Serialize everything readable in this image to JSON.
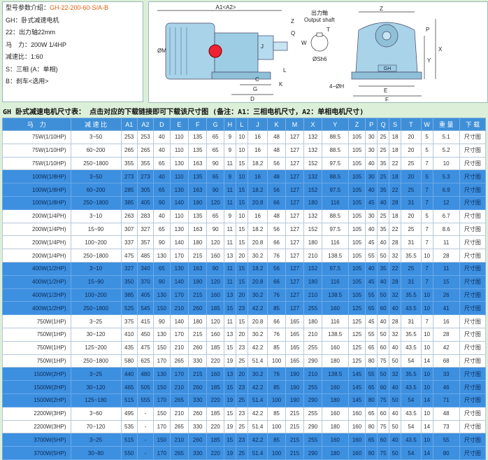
{
  "info": {
    "model_label": "型号参数介绍：",
    "model_code": "GH-22-200-60-S/A-B",
    "lines": [
      "GH：卧式减速电机",
      "22：出力轴22mm",
      "马　力：200W 1/4HP",
      "减速比：1:60",
      "S：三相 (A：单相)",
      "B：刹车<选用>"
    ]
  },
  "drawing": {
    "labels": {
      "a1": "A1<A2>",
      "output_cn": "出力軸",
      "output_en": "Output shaft",
      "z": "Z",
      "q": "Q",
      "j": "J",
      "m": "ØM",
      "w": "W",
      "t": "T",
      "s": "ØSh6",
      "g": "G",
      "k": "K",
      "c": "C",
      "d": "D",
      "l": "L",
      "h": "4−ØH",
      "y": "Y",
      "x": "X",
      "e": "E",
      "f": "F",
      "p": "P",
      "brand": "GH"
    }
  },
  "caption": "GH 卧式减速电机尺寸表： 点击对应的下载链接即可下载该尺寸图 (备注：A1：三相电机尺寸，A2：单相电机尺寸)",
  "table": {
    "headers": [
      "马　力",
      "减 速 比",
      "A1",
      "A2",
      "D",
      "E",
      "F",
      "G",
      "H",
      "L",
      "J",
      "K",
      "M",
      "X",
      "Y",
      "Z",
      "P",
      "Q",
      "S",
      "T",
      "W",
      "重 量",
      "下 载"
    ],
    "rows": [
      {
        "s": "w",
        "c": [
          "75W(1/10HP)",
          "3~50",
          "253",
          "253",
          "40",
          "110",
          "135",
          "65",
          "9",
          "10",
          "16",
          "48",
          "127",
          "132",
          "88.5",
          "105",
          "30",
          "25",
          "18",
          "20",
          "5",
          "5.1",
          "尺寸图"
        ]
      },
      {
        "s": "w",
        "c": [
          "75W(1/10HP)",
          "60~200",
          "265",
          "265",
          "40",
          "110",
          "135",
          "65",
          "9",
          "10",
          "16",
          "48",
          "127",
          "132",
          "88.5",
          "105",
          "30",
          "25",
          "18",
          "20",
          "5",
          "5.2",
          "尺寸图"
        ]
      },
      {
        "s": "w",
        "c": [
          "75W(1/10HP)",
          "250~1800",
          "355",
          "355",
          "65",
          "130",
          "163",
          "90",
          "11",
          "15",
          "18.2",
          "56",
          "127",
          "152",
          "97.5",
          "105",
          "40",
          "35",
          "22",
          "25",
          "7",
          "10",
          "尺寸图"
        ]
      },
      {
        "s": "b",
        "c": [
          "100W(1/8HP)",
          "3~50",
          "273",
          "273",
          "40",
          "110",
          "135",
          "65",
          "9",
          "10",
          "16",
          "48",
          "127",
          "132",
          "88.5",
          "105",
          "30",
          "25",
          "18",
          "20",
          "5",
          "5.3",
          "尺寸图"
        ]
      },
      {
        "s": "b",
        "c": [
          "100W(1/8HP)",
          "60~200",
          "285",
          "305",
          "65",
          "130",
          "163",
          "90",
          "11",
          "15",
          "18.2",
          "56",
          "127",
          "152",
          "97.5",
          "105",
          "40",
          "35",
          "22",
          "25",
          "7",
          "6.9",
          "尺寸图"
        ]
      },
      {
        "s": "b",
        "c": [
          "100W(1/8HP)",
          "250~1800",
          "385",
          "405",
          "90",
          "140",
          "180",
          "120",
          "11",
          "15",
          "20.8",
          "66",
          "127",
          "180",
          "116",
          "105",
          "45",
          "40",
          "28",
          "31",
          "7",
          "12",
          "尺寸图"
        ]
      },
      {
        "s": "w",
        "c": [
          "200W(1/4PH)",
          "3~10",
          "263",
          "283",
          "40",
          "110",
          "135",
          "65",
          "9",
          "10",
          "16",
          "48",
          "127",
          "132",
          "88.5",
          "105",
          "30",
          "25",
          "18",
          "20",
          "5",
          "6.7",
          "尺寸图"
        ]
      },
      {
        "s": "w",
        "c": [
          "200W(1/4PH)",
          "15~90",
          "307",
          "327",
          "65",
          "130",
          "163",
          "90",
          "11",
          "15",
          "18.2",
          "56",
          "127",
          "152",
          "97.5",
          "105",
          "40",
          "35",
          "22",
          "25",
          "7",
          "8.6",
          "尺寸图"
        ]
      },
      {
        "s": "w",
        "c": [
          "200W(1/4PH)",
          "100~200",
          "337",
          "357",
          "90",
          "140",
          "180",
          "120",
          "11",
          "15",
          "20.8",
          "66",
          "127",
          "180",
          "116",
          "105",
          "45",
          "40",
          "28",
          "31",
          "7",
          "11",
          "尺寸图"
        ]
      },
      {
        "s": "w",
        "c": [
          "200W(1/4PH)",
          "250~1800",
          "475",
          "485",
          "130",
          "170",
          "215",
          "160",
          "13",
          "20",
          "30.2",
          "76",
          "127",
          "210",
          "138.5",
          "105",
          "55",
          "50",
          "32",
          "35.5",
          "10",
          "28",
          "尺寸图"
        ]
      },
      {
        "s": "b",
        "c": [
          "400W(1/2HP)",
          "3~10",
          "327",
          "340",
          "65",
          "130",
          "163",
          "90",
          "11",
          "15",
          "18.2",
          "56",
          "127",
          "152",
          "97.5",
          "105",
          "40",
          "35",
          "22",
          "25",
          "7",
          "11",
          "尺寸图"
        ]
      },
      {
        "s": "b",
        "c": [
          "400W(1/2HP)",
          "15~90",
          "350",
          "370",
          "90",
          "140",
          "180",
          "120",
          "11",
          "15",
          "20.8",
          "66",
          "127",
          "180",
          "116",
          "105",
          "45",
          "40",
          "28",
          "31",
          "7",
          "15",
          "尺寸图"
        ]
      },
      {
        "s": "b",
        "c": [
          "400W(1/2HP)",
          "100~200",
          "385",
          "405",
          "130",
          "170",
          "215",
          "160",
          "13",
          "20",
          "30.2",
          "76",
          "127",
          "210",
          "138.5",
          "105",
          "55",
          "50",
          "32",
          "35.5",
          "10",
          "26",
          "尺寸图"
        ]
      },
      {
        "s": "b",
        "c": [
          "400W(1/2HP)",
          "250~1800",
          "525",
          "545",
          "150",
          "210",
          "260",
          "185",
          "15",
          "23",
          "42.2",
          "85",
          "127",
          "255",
          "160",
          "125",
          "65",
          "60",
          "40",
          "43.5",
          "10",
          "41",
          "尺寸图"
        ]
      },
      {
        "s": "w",
        "c": [
          "750W(1HP)",
          "3~25",
          "375",
          "415",
          "90",
          "140",
          "180",
          "120",
          "11",
          "15",
          "20.8",
          "66",
          "165",
          "180",
          "116",
          "125",
          "45",
          "40",
          "28",
          "31",
          "7",
          "16",
          "尺寸图"
        ]
      },
      {
        "s": "w",
        "c": [
          "750W(1HP)",
          "30~120",
          "410",
          "450",
          "130",
          "170",
          "215",
          "160",
          "13",
          "20",
          "30.2",
          "76",
          "165",
          "210",
          "138.5",
          "125",
          "55",
          "50",
          "32",
          "35.5",
          "10",
          "28",
          "尺寸图"
        ]
      },
      {
        "s": "w",
        "c": [
          "750W(1HP)",
          "125~200",
          "435",
          "475",
          "150",
          "210",
          "260",
          "185",
          "15",
          "23",
          "42.2",
          "85",
          "165",
          "255",
          "160",
          "125",
          "65",
          "60",
          "40",
          "43.5",
          "10",
          "42",
          "尺寸图"
        ]
      },
      {
        "s": "w",
        "c": [
          "750W(1HP)",
          "250~1800",
          "580",
          "625",
          "170",
          "265",
          "330",
          "220",
          "19",
          "25",
          "51.4",
          "100",
          "165",
          "290",
          "180",
          "125",
          "80",
          "75",
          "50",
          "54",
          "14",
          "68",
          "尺寸图"
        ]
      },
      {
        "s": "b",
        "c": [
          "1500W(2HP)",
          "3~25",
          "440",
          "480",
          "130",
          "170",
          "215",
          "160",
          "13",
          "20",
          "30.2",
          "76",
          "190",
          "210",
          "138.5",
          "145",
          "55",
          "50",
          "32",
          "35.5",
          "10",
          "33",
          "尺寸图"
        ]
      },
      {
        "s": "b",
        "c": [
          "1500W(2HP)",
          "30~120",
          "465",
          "505",
          "150",
          "210",
          "260",
          "185",
          "15",
          "23",
          "42.2",
          "85",
          "190",
          "255",
          "160",
          "145",
          "65",
          "60",
          "40",
          "43.5",
          "10",
          "46",
          "尺寸图"
        ]
      },
      {
        "s": "b",
        "c": [
          "1500W(2HP)",
          "125~180",
          "515",
          "555",
          "170",
          "265",
          "330",
          "220",
          "19",
          "25",
          "51.4",
          "100",
          "190",
          "290",
          "180",
          "145",
          "80",
          "75",
          "50",
          "54",
          "14",
          "71",
          "尺寸图"
        ]
      },
      {
        "s": "w",
        "c": [
          "2200W(3HP)",
          "3~60",
          "495",
          "-",
          "150",
          "210",
          "260",
          "185",
          "15",
          "23",
          "42.2",
          "85",
          "215",
          "255",
          "160",
          "160",
          "65",
          "60",
          "40",
          "43.5",
          "10",
          "48",
          "尺寸图"
        ]
      },
      {
        "s": "w",
        "c": [
          "2200W(3HP)",
          "70~120",
          "535",
          "-",
          "170",
          "265",
          "330",
          "220",
          "19",
          "25",
          "51.4",
          "100",
          "215",
          "290",
          "180",
          "160",
          "80",
          "75",
          "50",
          "54",
          "14",
          "73",
          "尺寸图"
        ]
      },
      {
        "s": "b",
        "c": [
          "3700W(5HP)",
          "3~25",
          "515",
          "-",
          "150",
          "210",
          "260",
          "185",
          "15",
          "23",
          "42.2",
          "85",
          "215",
          "255",
          "160",
          "160",
          "65",
          "60",
          "40",
          "43.5",
          "10",
          "55",
          "尺寸图"
        ]
      },
      {
        "s": "b",
        "c": [
          "3700W(5HP)",
          "30~80",
          "550",
          "-",
          "170",
          "265",
          "330",
          "220",
          "19",
          "25",
          "51.4",
          "100",
          "215",
          "290",
          "180",
          "160",
          "80",
          "75",
          "50",
          "54",
          "14",
          "80",
          "尺寸图"
        ]
      }
    ]
  },
  "colors": {
    "header": "#3f8fd8",
    "row_blue": "#3d8fe0",
    "row_white": "#ffffff",
    "background": "#dcefd8",
    "model_code": "#e06010"
  }
}
